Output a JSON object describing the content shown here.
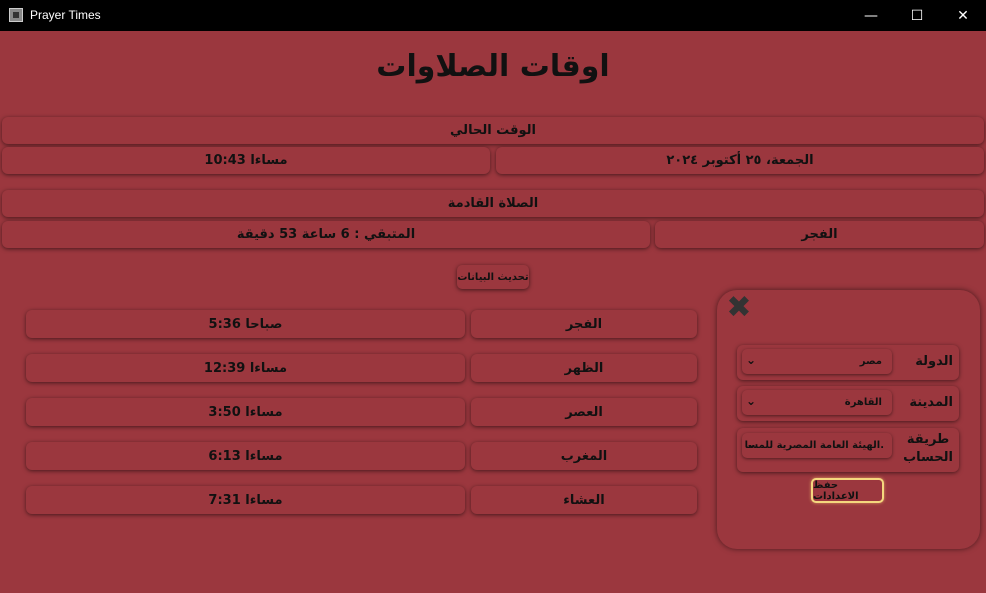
{
  "window": {
    "title": "Prayer Times",
    "minimize": "—",
    "maximize": "☐",
    "close": "✕"
  },
  "page": {
    "title": "اوقات الصلاوات"
  },
  "current": {
    "header": "الوقت الحالي",
    "date": "الجمعة، ٢٥ أكتوبر ٢٠٢٤",
    "time": "10:43 مساءا"
  },
  "next": {
    "header": "الصلاة القادمة",
    "name": "الفجر",
    "remaining": "المتبقي : 6 ساعة 53 دقيقة"
  },
  "refresh_label": "تحديث البيانات",
  "prayers": [
    {
      "name": "الفجر",
      "time": "5:36 صباحا"
    },
    {
      "name": "الظهر",
      "time": "12:39 مساءا"
    },
    {
      "name": "العصر",
      "time": "3:50 مساءا"
    },
    {
      "name": "المغرب",
      "time": "6:13 مساءا"
    },
    {
      "name": "العشاء",
      "time": "7:31 مساءا"
    }
  ],
  "settings": {
    "country": {
      "label": "الدولة",
      "value": "مصر"
    },
    "city": {
      "label": "المدينة",
      "value": "القاهرة"
    },
    "method": {
      "label_line1": "طريقة",
      "label_line2": "الحساب",
      "value": "الهيئة العامة المصرية للمسا."
    },
    "save_label": "حفظ الاعدادات",
    "close_icon": "✖"
  },
  "colors": {
    "background": "#9b373e",
    "accent_border": "#f5d77e"
  }
}
